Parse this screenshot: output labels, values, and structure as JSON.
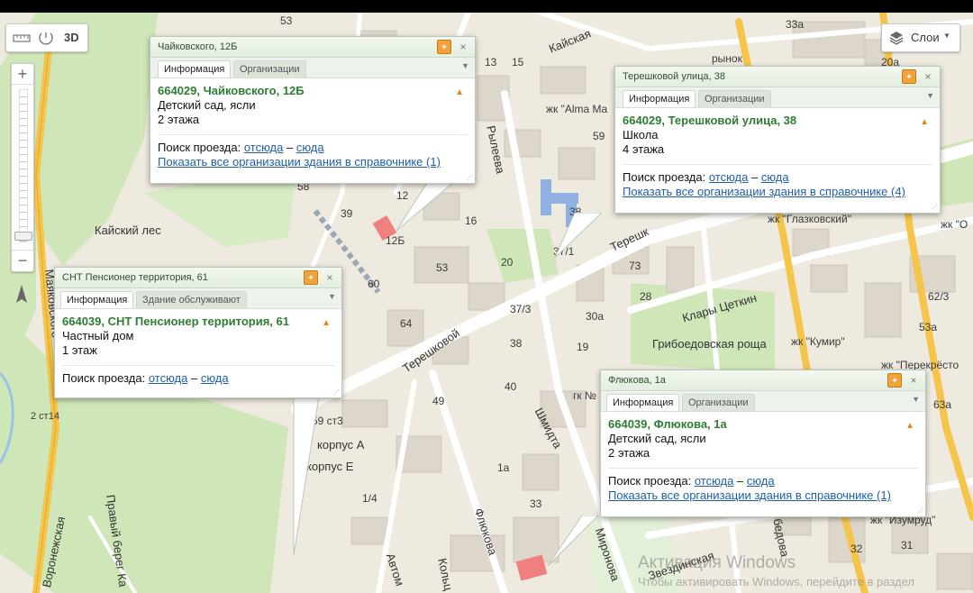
{
  "controls": {
    "mode_3d": "3D",
    "layers_label": "Слои",
    "zoom_in": "+",
    "zoom_out": "−"
  },
  "map": {
    "watermark": {
      "line1": "Активация Windows",
      "line2": "Чтобы активировать Windows, перейдите в раздел"
    },
    "labels": {
      "n53": "53",
      "kayskaya": "Кайская",
      "n33a": "33а",
      "rynok": "рынок",
      "n20a": "20а",
      "n13": "13",
      "n15": "15",
      "zhk_alma": "жк \"Alma Ma",
      "n59": "59",
      "ryleeva": "Рылеева",
      "n58": "58",
      "n12": "12",
      "n16": "16",
      "n39": "39",
      "n38": "38",
      "teresh_top": "Терешк",
      "zhk_glaz": "жк \"Глазковский\"",
      "zhk_o": "жк \"О",
      "kaysky_les": "Кайский лес",
      "n12b": "12Б",
      "n53b": "53",
      "n20": "20",
      "n37_1": "37/1",
      "n73": "73",
      "klary": "Клары Цеткин",
      "kumir_icon": "Кумир",
      "n60": "60",
      "n28": "28",
      "n62_3": "62/3",
      "n37_3": "37/3",
      "n30a": "30а",
      "n64": "64",
      "tereshkovoy": "Терешковой",
      "griboed": "Грибоедовская роща",
      "zhk_kumir": "жк \"Кумир\"",
      "n53a": "53а",
      "n38b": "38",
      "n19": "19",
      "zhk_perek": "жк \"Перекрёсто",
      "n40": "40",
      "gk": "гк №",
      "n49": "49",
      "n59_st3": "59 ст3",
      "n63a": "63а",
      "korpus_a": "корпус А",
      "korpus_e": "корпус Е",
      "n1a": "1а",
      "n1_4": "1/4",
      "n33": "33",
      "zhk_izumrud": "жк \"Изумруд\"",
      "zvezdinskaya": "Звездинская",
      "n32": "32",
      "n31": "31",
      "avtom": "Автом",
      "kolts": "Кольц",
      "flyukova_st": "Флюкова",
      "mironova": "Миронова",
      "shmidta": "Шмидта",
      "edova": "бедова",
      "pravy_bereg": "Правый берег Ка",
      "voronezhskaya": "Воронежская",
      "mayakovskogo": "Маяковского",
      "n2_st14": "2 ст14",
      "mayakovsk_faint": "Маяковск"
    }
  },
  "balloons": {
    "chaykovskogo": {
      "header": "Чайковского, 12Б",
      "tab_info": "Информация",
      "tab_other": "Организации",
      "title": "664029, Чайковского, 12Б",
      "line1": "Детский сад, ясли",
      "line2": "2 этажа",
      "route_label": "Поиск проезда:",
      "route_from": "отсюда",
      "route_sep": "–",
      "route_to": "сюда",
      "orgs_link": "Показать все организации здания в справочнике (1)"
    },
    "tereshkovoy": {
      "header": "Терешковой улица, 38",
      "tab_info": "Информация",
      "tab_other": "Организации",
      "title": "664029, Терешковой улица, 38",
      "line1": "Школа",
      "line2": "4 этажа",
      "route_label": "Поиск проезда:",
      "route_from": "отсюда",
      "route_sep": "–",
      "route_to": "сюда",
      "orgs_link": "Показать все организации здания в справочнике (4)"
    },
    "snt": {
      "header": "СНТ Пенсионер территория, 61",
      "tab_info": "Информация",
      "tab_other": "Здание обслуживают",
      "title": "664039, СНТ Пенсионер территория, 61",
      "line1": "Частный дом",
      "line2": "1 этаж",
      "route_label": "Поиск проезда:",
      "route_from": "отсюда",
      "route_sep": "–",
      "route_to": "сюда"
    },
    "flyukova": {
      "header": "Флюкова, 1а",
      "tab_info": "Информация",
      "tab_other": "Организации",
      "title": "664039, Флюкова, 1а",
      "line1": "Детский сад, ясли",
      "line2": "2 этажа",
      "route_label": "Поиск проезда:",
      "route_from": "отсюда",
      "route_sep": "–",
      "route_to": "сюда",
      "orgs_link": "Показать все организации здания в справочнике (1)"
    }
  },
  "colors": {
    "park_green": "#cfe6b8",
    "road_yellow": "#f4c54a",
    "road_white": "#ffffff",
    "link_blue": "#1f5fa8",
    "title_green": "#2e7d32"
  },
  "icons": [
    "ruler-icon",
    "measure-icon",
    "layers-icon",
    "pin-icon",
    "close-icon",
    "warning-icon",
    "compass-icon"
  ]
}
